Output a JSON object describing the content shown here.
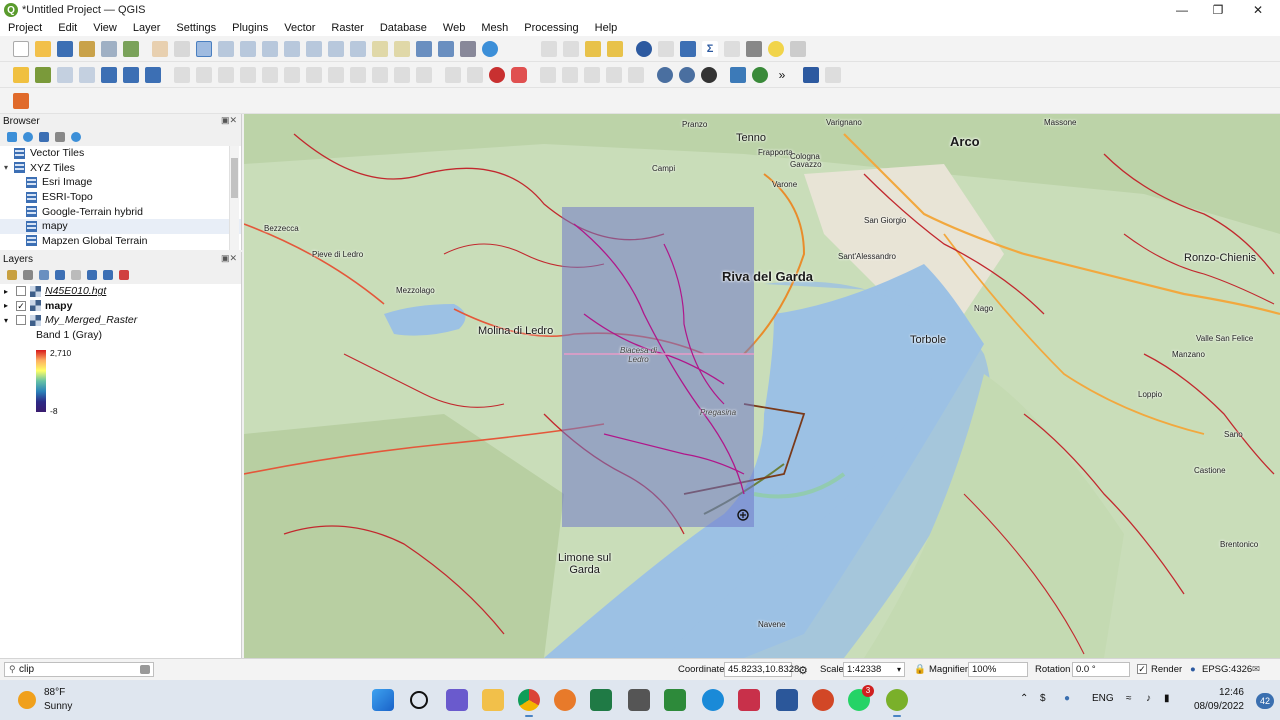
{
  "window": {
    "title": "*Untitled Project — QGIS"
  },
  "menu": [
    "Project",
    "Edit",
    "View",
    "Layer",
    "Settings",
    "Plugins",
    "Vector",
    "Raster",
    "Database",
    "Web",
    "Mesh",
    "Processing",
    "Help"
  ],
  "browser": {
    "title": "Browser",
    "items": [
      {
        "label": "Vector Tiles",
        "expanded": false
      },
      {
        "label": "XYZ Tiles",
        "expanded": true
      },
      {
        "label": "Esri Image"
      },
      {
        "label": "ESRI-Topo"
      },
      {
        "label": "Google-Terrain hybrid"
      },
      {
        "label": "mapy"
      },
      {
        "label": "Mapzen Global Terrain"
      }
    ]
  },
  "layers": {
    "title": "Layers",
    "items": [
      {
        "label": "N45E010.hgt",
        "checked": false
      },
      {
        "label": "mapy",
        "checked": true
      },
      {
        "label": "My_Merged_Raster",
        "checked": false
      }
    ],
    "legend": {
      "band": "Band 1 (Gray)",
      "max": "2,710",
      "min": "-8"
    }
  },
  "map": {
    "labels": {
      "arco": "Arco",
      "riva": "Riva del Garda",
      "molina": "Molina di Ledro",
      "torbole": "Torbole",
      "limone": "Limone sul\nGarda",
      "tenno": "Tenno",
      "pieve": "Pieve di Ledro",
      "mezzolago": "Mezzolago",
      "bezzecca": "Bezzecca",
      "varignano": "Varignano",
      "massone": "Massone",
      "frapporta": "Frapporta",
      "cologna": "Cologna",
      "gavazzo": "Gavazzo",
      "varone": "Varone",
      "campi": "Campi",
      "pranzo": "Pranzo",
      "sangiorgio": "San Giorgio",
      "santalessandro": "Sant'Alessandro",
      "nago": "Nago",
      "ronzo": "Ronzo-Chienis",
      "biacesa": "Biacesa di\nLedro",
      "pregasina": "Pregasina",
      "manzano": "Manzano",
      "loppio": "Loppio",
      "sano": "Sano",
      "castione": "Castione",
      "brentonico": "Brentonico",
      "navene": "Navene",
      "vallesanfelice": "Valle San Felice"
    }
  },
  "status": {
    "search": "clip",
    "coordinate_label": "Coordinate",
    "coordinate": "45.8233,10.8328",
    "scale_label": "Scale",
    "scale": "1:42338",
    "magnifier_label": "Magnifier",
    "magnifier": "100%",
    "rotation_label": "Rotation",
    "rotation": "0.0 °",
    "render_label": "Render",
    "epsg": "EPSG:4326"
  },
  "taskbar": {
    "temp": "88°F",
    "weather": "Sunny",
    "lang": "ENG",
    "time": "12:46",
    "date": "08/09/2022",
    "notifications": "42",
    "whatsapp_badge": "3"
  },
  "colors": {
    "accent": "#2d5aa0",
    "lake": "#9cc1e4",
    "land": "#cfe3c0",
    "overlay": "#6f78c8"
  }
}
